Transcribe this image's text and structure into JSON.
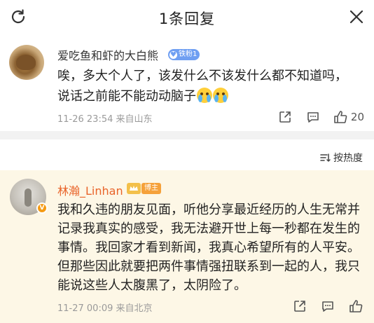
{
  "header": {
    "title": "1条回复",
    "refresh_icon": "refresh-icon",
    "close_icon": "close-icon"
  },
  "top_comment": {
    "username": "爱吃鱼和虾的大白熊",
    "fan_badge": "铁粉1",
    "text_line1": "唉，多大个人了，该发什么不该发什么都不知道吗，",
    "text_line2": "说话之前能不能动动脑子",
    "emoji": "crying-face",
    "time": "11-26 23:54",
    "location": "来自山东",
    "like_count": "20"
  },
  "sort": {
    "label": "按热度",
    "icon": "sort-icon"
  },
  "reply": {
    "username": "林瀚_Linhan",
    "badge": "博主",
    "verified": "V",
    "text_lines": [
      "我和久违的朋友见面，听他分享最近经历的人生无常并",
      "记录我真实的感受，我无法避开世上每一秒都在发生的",
      "事情。我回家才看到新闻，我真心希望所有的人平安。",
      "但那些因此就要把两件事情强扭联系到一起的人，我只",
      "能说这些人太腹黑了，太阴险了。"
    ],
    "time": "11-27 00:09",
    "location": "来自北京"
  },
  "colors": {
    "accent_name": "#e9642a",
    "reply_bg": "#fdf7e6",
    "separator": "#f2f2f2",
    "meta_text": "#9a9a9a"
  }
}
